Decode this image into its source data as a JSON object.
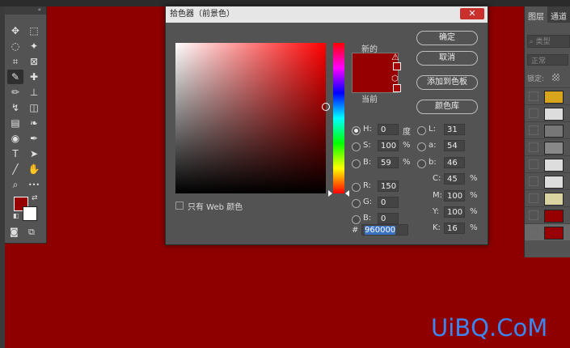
{
  "toolbar": {
    "header_glyph": "«",
    "tools": [
      {
        "name": "move-tool-icon",
        "glyph": "✥"
      },
      {
        "name": "marquee-tool-icon",
        "glyph": "⬚"
      },
      {
        "name": "lasso-tool-icon",
        "glyph": "◌"
      },
      {
        "name": "magic-wand-tool-icon",
        "glyph": "✦"
      },
      {
        "name": "crop-tool-icon",
        "glyph": "⌗"
      },
      {
        "name": "frame-tool-icon",
        "glyph": "⊠"
      },
      {
        "name": "eyedropper-tool-icon",
        "glyph": "✎"
      },
      {
        "name": "healing-brush-tool-icon",
        "glyph": "✚"
      },
      {
        "name": "brush-tool-icon",
        "glyph": "✏"
      },
      {
        "name": "clone-stamp-tool-icon",
        "glyph": "⊥"
      },
      {
        "name": "history-brush-tool-icon",
        "glyph": "↯"
      },
      {
        "name": "eraser-tool-icon",
        "glyph": "◫"
      },
      {
        "name": "gradient-tool-icon",
        "glyph": "▤"
      },
      {
        "name": "blur-tool-icon",
        "glyph": "❧"
      },
      {
        "name": "dodge-tool-icon",
        "glyph": "◉"
      },
      {
        "name": "pen-tool-icon",
        "glyph": "✒"
      },
      {
        "name": "type-tool-icon",
        "glyph": "T"
      },
      {
        "name": "path-selection-tool-icon",
        "glyph": "➤"
      },
      {
        "name": "line-tool-icon",
        "glyph": "╱"
      },
      {
        "name": "hand-tool-icon",
        "glyph": "✋"
      },
      {
        "name": "zoom-tool-icon",
        "glyph": "⌕"
      },
      {
        "name": "more-tools-icon",
        "glyph": "•••"
      }
    ],
    "swap_glyph": "⇄",
    "reset_glyph": "◧",
    "quickmask_glyph": "◙",
    "screenmode_glyph": "⧉",
    "foreground_color": "#960000",
    "background_color": "#ffffff"
  },
  "layers_panel": {
    "tab_layers": "图层",
    "tab_channels": "通道",
    "search_placeholder": "类型",
    "blend_mode": "正常",
    "lock_label": "锁定:"
  },
  "dialog": {
    "title": "拾色器（前景色）",
    "close_glyph": "✕",
    "label_new": "新的",
    "label_current": "当前",
    "new_color": "#960000",
    "current_color": "#960000",
    "warning_glyph": "⚠",
    "cube_glyph": "⬡",
    "ok_label": "确定",
    "cancel_label": "取消",
    "add_to_swatches_label": "添加到色板",
    "color_libraries_label": "颜色库",
    "web_only_label": "只有 Web 颜色",
    "hsb": [
      {
        "key": "H:",
        "value": "0",
        "unit": "度",
        "selected": true
      },
      {
        "key": "S:",
        "value": "100",
        "unit": "%",
        "selected": false
      },
      {
        "key": "B:",
        "value": "59",
        "unit": "%",
        "selected": false
      }
    ],
    "rgb": [
      {
        "key": "R:",
        "value": "150",
        "selected": false
      },
      {
        "key": "G:",
        "value": "0",
        "selected": false
      },
      {
        "key": "B:",
        "value": "0",
        "selected": false
      }
    ],
    "lab": [
      {
        "key": "L:",
        "value": "31"
      },
      {
        "key": "a:",
        "value": "54"
      },
      {
        "key": "b:",
        "value": "46"
      }
    ],
    "cmyk": [
      {
        "key": "C:",
        "value": "45",
        "unit": "%"
      },
      {
        "key": "M:",
        "value": "100",
        "unit": "%"
      },
      {
        "key": "Y:",
        "value": "100",
        "unit": "%"
      },
      {
        "key": "K:",
        "value": "16",
        "unit": "%"
      }
    ],
    "hex_prefix": "#",
    "hex_value": "960000"
  },
  "watermark": "UiBQ.CoM"
}
